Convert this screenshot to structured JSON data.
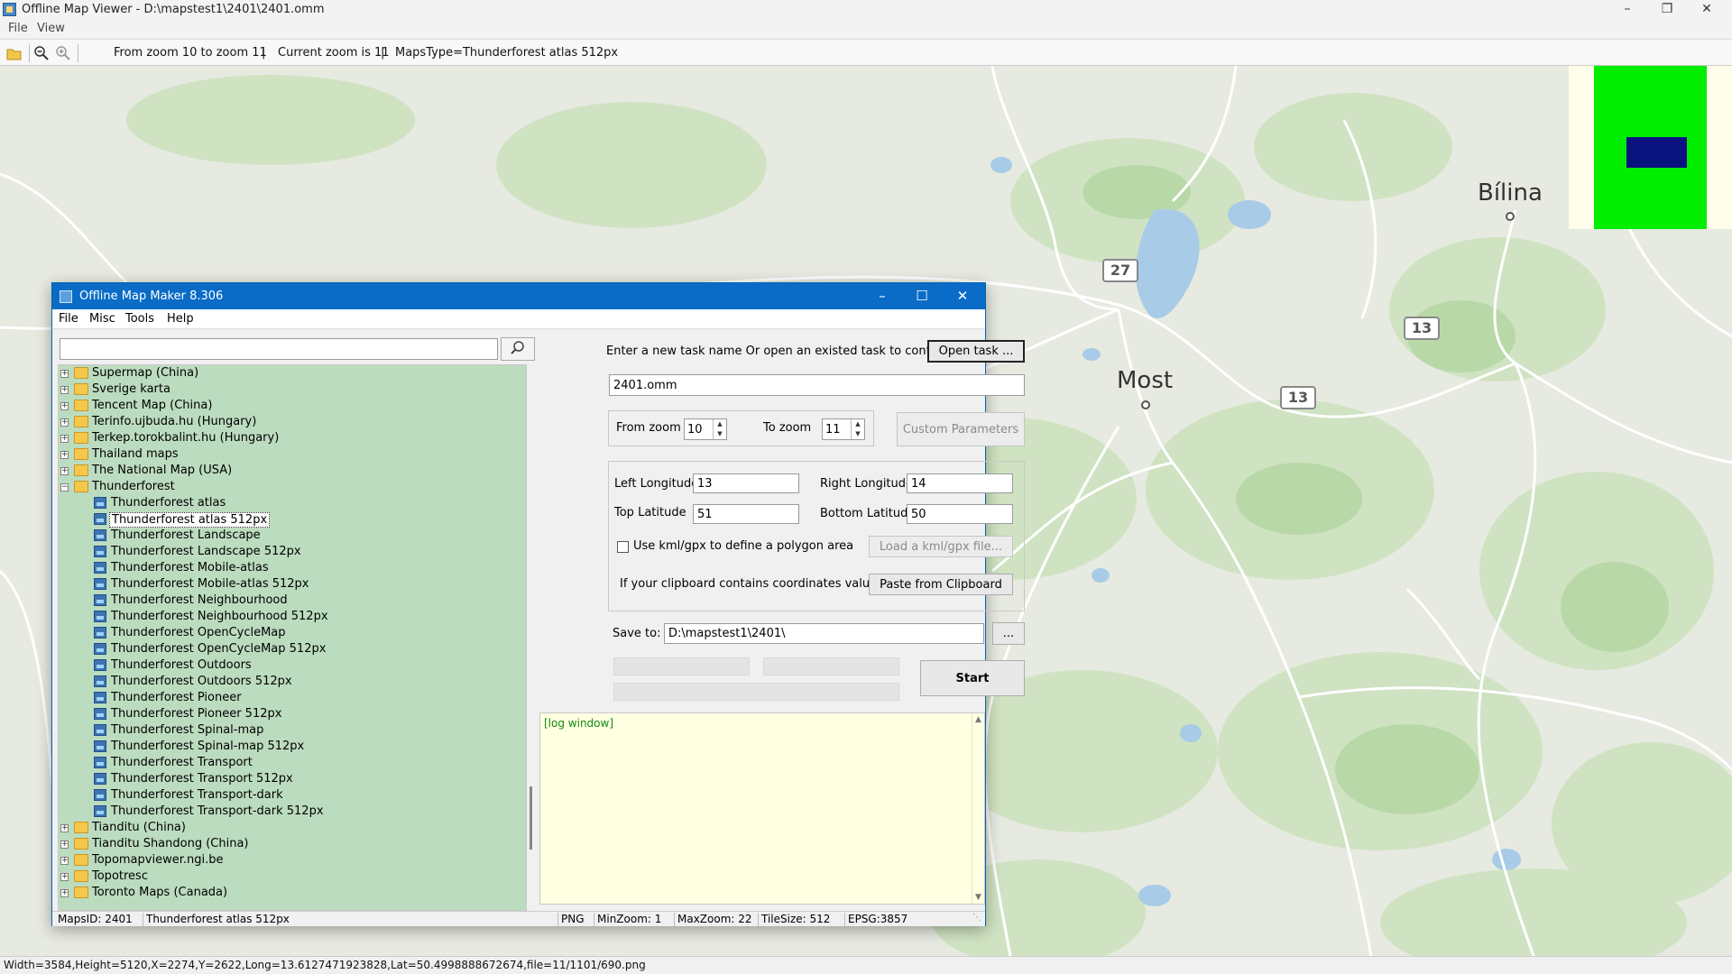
{
  "window": {
    "title": "Offline Map Viewer - D:\\mapstest1\\2401\\2401.omm",
    "menu": [
      "File",
      "View"
    ]
  },
  "toolbar": {
    "zoom_range": "From zoom 10 to zoom 11",
    "current_zoom": "Current zoom is 11",
    "maps_type": "MapsType=Thunderforest atlas 512px",
    "sep1": "|",
    "sep2": "|"
  },
  "map": {
    "towns": [
      "Bílina",
      "Most"
    ],
    "roads": [
      "27",
      "13",
      "13"
    ]
  },
  "status_bar": {
    "text": "Width=3584,Height=5120,X=2274,Y=2622,Long=13.6127471923828,Lat=50.4998888672674,file=11/1101/690.png"
  },
  "dialog": {
    "title": "Offline Map Maker 8.306",
    "menu": [
      "File",
      "Misc",
      "Tools",
      "Help"
    ],
    "search": {
      "value": "",
      "placeholder": ""
    },
    "tree": [
      {
        "label": "Supermap (China)",
        "level": 0,
        "expanded": false
      },
      {
        "label": "Sverige karta",
        "level": 0,
        "expanded": false
      },
      {
        "label": "Tencent Map (China)",
        "level": 0,
        "expanded": false
      },
      {
        "label": "Terinfo.ujbuda.hu (Hungary)",
        "level": 0,
        "expanded": false
      },
      {
        "label": "Terkep.torokbalint.hu (Hungary)",
        "level": 0,
        "expanded": false
      },
      {
        "label": "Thailand maps",
        "level": 0,
        "expanded": false
      },
      {
        "label": "The National Map (USA)",
        "level": 0,
        "expanded": false
      },
      {
        "label": "Thunderforest",
        "level": 0,
        "expanded": true
      },
      {
        "label": "Thunderforest atlas",
        "level": 1
      },
      {
        "label": "Thunderforest atlas 512px",
        "level": 1,
        "selected": true
      },
      {
        "label": "Thunderforest Landscape",
        "level": 1
      },
      {
        "label": "Thunderforest Landscape 512px",
        "level": 1
      },
      {
        "label": "Thunderforest Mobile-atlas",
        "level": 1
      },
      {
        "label": "Thunderforest Mobile-atlas 512px",
        "level": 1
      },
      {
        "label": "Thunderforest Neighbourhood",
        "level": 1
      },
      {
        "label": "Thunderforest Neighbourhood 512px",
        "level": 1
      },
      {
        "label": "Thunderforest OpenCycleMap",
        "level": 1
      },
      {
        "label": "Thunderforest OpenCycleMap 512px",
        "level": 1
      },
      {
        "label": "Thunderforest Outdoors",
        "level": 1
      },
      {
        "label": "Thunderforest Outdoors 512px",
        "level": 1
      },
      {
        "label": "Thunderforest Pioneer",
        "level": 1
      },
      {
        "label": "Thunderforest Pioneer 512px",
        "level": 1
      },
      {
        "label": "Thunderforest Spinal-map",
        "level": 1
      },
      {
        "label": "Thunderforest Spinal-map 512px",
        "level": 1
      },
      {
        "label": "Thunderforest Transport",
        "level": 1
      },
      {
        "label": "Thunderforest Transport 512px",
        "level": 1
      },
      {
        "label": "Thunderforest Transport-dark",
        "level": 1
      },
      {
        "label": "Thunderforest Transport-dark 512px",
        "level": 1
      },
      {
        "label": "Tianditu (China)",
        "level": 0,
        "expanded": false
      },
      {
        "label": "Tianditu Shandong (China)",
        "level": 0,
        "expanded": false
      },
      {
        "label": "Topomapviewer.ngi.be",
        "level": 0,
        "expanded": false
      },
      {
        "label": "Topotresc",
        "level": 0,
        "expanded": false
      },
      {
        "label": "Toronto Maps (Canada)",
        "level": 0,
        "expanded": false
      }
    ],
    "task": {
      "prompt": "Enter a new task name Or open an existed task to continue:",
      "open_button": "Open task ...",
      "name_value": "2401.omm"
    },
    "zoom": {
      "from_label": "From zoom",
      "from_value": "10",
      "to_label": "To zoom",
      "to_value": "11",
      "custom_button": "Custom Parameters"
    },
    "coords": {
      "left_lon_label": "Left Longitude",
      "left_lon_value": "13",
      "right_lon_label": "Right Longitude",
      "right_lon_value": "14",
      "top_lat_label": "Top Latitude",
      "top_lat_value": "51",
      "bottom_lat_label": "Bottom Latitude",
      "bottom_lat_value": "50",
      "kml_label": "Use kml/gpx to define a polygon area",
      "kml_button": "Load a kml/gpx file...",
      "clipboard_label": "If your clipboard contains coordinates values:",
      "clipboard_button": "Paste from Clipboard"
    },
    "save": {
      "label": "Save to:",
      "value": "D:\\mapstest1\\2401\\",
      "browse_button": "...",
      "start_button": "Start"
    },
    "log": {
      "text": "[log window]"
    },
    "status": {
      "maps_id": "MapsID: 2401",
      "map_name": "Thunderforest atlas 512px",
      "format": "PNG",
      "min_zoom": "MinZoom: 1",
      "max_zoom": "MaxZoom: 22",
      "tile_size": "TileSize: 512",
      "epsg": "EPSG:3857"
    }
  }
}
